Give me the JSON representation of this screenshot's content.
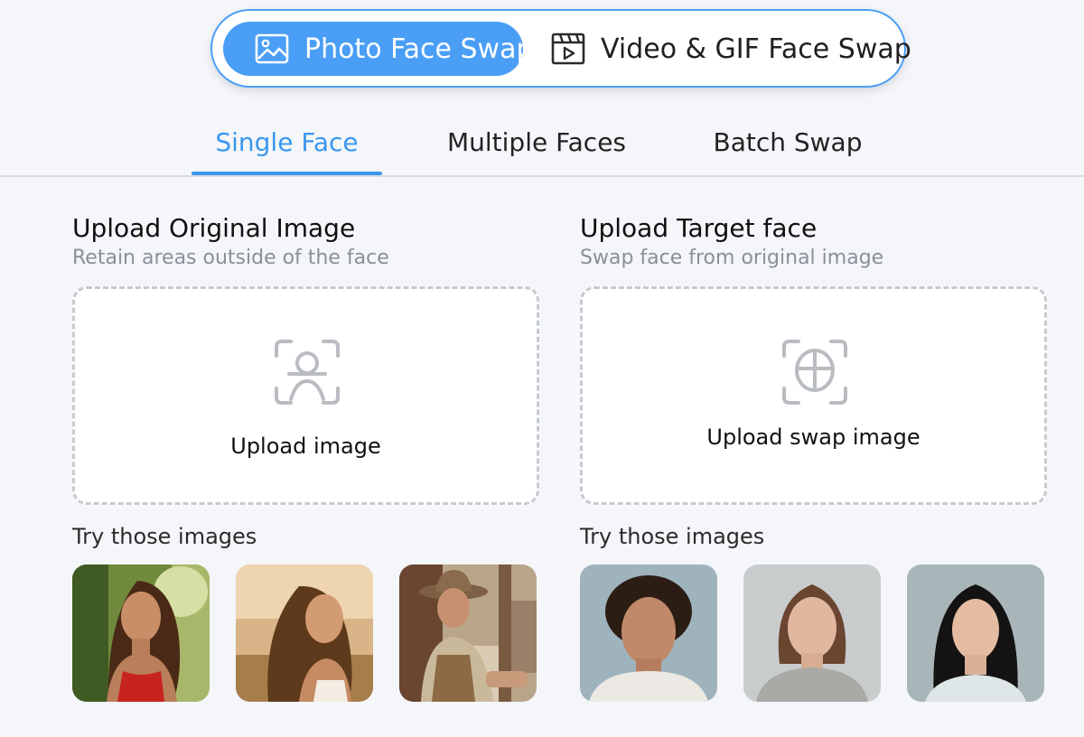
{
  "mode_switch": {
    "photo_label": "Photo Face Swap",
    "photo_icon": "image-icon",
    "video_label": "Video & GIF Face Swap",
    "video_icon": "video-clapper-icon",
    "accent_color": "#4a9ef5"
  },
  "subtabs": {
    "items": [
      {
        "label": "Single Face",
        "active": true
      },
      {
        "label": "Multiple Faces",
        "active": false
      },
      {
        "label": "Batch Swap",
        "active": false
      }
    ]
  },
  "original": {
    "title": "Upload Original Image",
    "subtitle": "Retain areas outside of the face",
    "upload_label": "Upload image",
    "upload_icon": "face-scan-icon",
    "try_label": "Try those images",
    "samples": [
      {
        "name": "sample-woman-forest"
      },
      {
        "name": "sample-woman-sunset"
      },
      {
        "name": "sample-cowboy"
      }
    ]
  },
  "target": {
    "title": "Upload Target face",
    "subtitle": "Swap face from original image",
    "upload_label": "Upload swap image",
    "upload_icon": "face-target-icon",
    "try_label": "Try those images",
    "samples": [
      {
        "name": "sample-curly-man"
      },
      {
        "name": "sample-woman-sweater"
      },
      {
        "name": "sample-asian-woman"
      }
    ]
  }
}
